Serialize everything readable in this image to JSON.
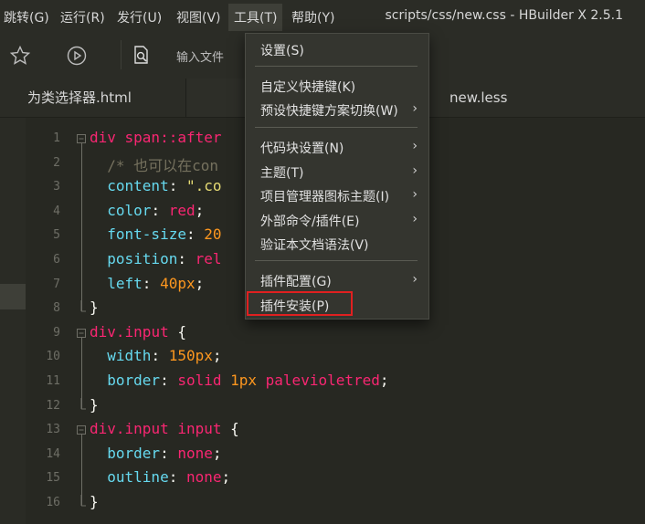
{
  "menubar": {
    "items": [
      "跳转(G)",
      "运行(R)",
      "发行(U)",
      "视图(V)",
      "工具(T)",
      "帮助(Y)"
    ],
    "title": "scripts/css/new.css - HBuilder X 2.5.1"
  },
  "toolbar": {
    "input_placeholder": "输入文件"
  },
  "tabs": [
    "为类选择器.html",
    "new.less"
  ],
  "editor": {
    "lines": [
      {
        "n": "1",
        "parts": [
          {
            "t": "div ",
            "c": "k"
          },
          {
            "t": "span",
            "c": "k"
          },
          {
            "t": "::after",
            "c": "k"
          }
        ]
      },
      {
        "n": "2",
        "parts": [
          {
            "t": "  /* 也可以在con",
            "c": "c"
          }
        ]
      },
      {
        "n": "3",
        "parts": [
          {
            "t": "  content",
            "c": "p"
          },
          {
            "t": ": ",
            "c": "w"
          },
          {
            "t": "\".co",
            "c": "s"
          }
        ]
      },
      {
        "n": "4",
        "parts": [
          {
            "t": "  color",
            "c": "p"
          },
          {
            "t": ": ",
            "c": "w"
          },
          {
            "t": "red",
            "c": "k"
          },
          {
            "t": ";",
            "c": "w"
          }
        ]
      },
      {
        "n": "5",
        "parts": [
          {
            "t": "  font-size",
            "c": "p"
          },
          {
            "t": ": ",
            "c": "w"
          },
          {
            "t": "20",
            "c": "v"
          }
        ]
      },
      {
        "n": "6",
        "parts": [
          {
            "t": "  position",
            "c": "p"
          },
          {
            "t": ": ",
            "c": "w"
          },
          {
            "t": "rel",
            "c": "k"
          }
        ]
      },
      {
        "n": "7",
        "parts": [
          {
            "t": "  left",
            "c": "p"
          },
          {
            "t": ": ",
            "c": "w"
          },
          {
            "t": "40px",
            "c": "v"
          },
          {
            "t": ";",
            "c": "w"
          }
        ]
      },
      {
        "n": "8",
        "parts": [
          {
            "t": "}",
            "c": "w"
          }
        ]
      },
      {
        "n": "9",
        "parts": [
          {
            "t": "div",
            "c": "k"
          },
          {
            "t": ".input",
            "c": "k"
          },
          {
            "t": " {",
            "c": "w"
          }
        ]
      },
      {
        "n": "10",
        "parts": [
          {
            "t": "  width",
            "c": "p"
          },
          {
            "t": ": ",
            "c": "w"
          },
          {
            "t": "150px",
            "c": "v"
          },
          {
            "t": ";",
            "c": "w"
          }
        ]
      },
      {
        "n": "11",
        "parts": [
          {
            "t": "  border",
            "c": "p"
          },
          {
            "t": ": ",
            "c": "w"
          },
          {
            "t": "solid ",
            "c": "k"
          },
          {
            "t": "1px ",
            "c": "v"
          },
          {
            "t": "palevioletred",
            "c": "k"
          },
          {
            "t": ";",
            "c": "w"
          }
        ]
      },
      {
        "n": "12",
        "parts": [
          {
            "t": "}",
            "c": "w"
          }
        ]
      },
      {
        "n": "13",
        "parts": [
          {
            "t": "div",
            "c": "k"
          },
          {
            "t": ".input ",
            "c": "k"
          },
          {
            "t": "input",
            "c": "k"
          },
          {
            "t": " {",
            "c": "w"
          }
        ]
      },
      {
        "n": "14",
        "parts": [
          {
            "t": "  border",
            "c": "p"
          },
          {
            "t": ": ",
            "c": "w"
          },
          {
            "t": "none",
            "c": "k"
          },
          {
            "t": ";",
            "c": "w"
          }
        ]
      },
      {
        "n": "15",
        "parts": [
          {
            "t": "  outline",
            "c": "p"
          },
          {
            "t": ": ",
            "c": "w"
          },
          {
            "t": "none",
            "c": "k"
          },
          {
            "t": ";",
            "c": "w"
          }
        ]
      },
      {
        "n": "16",
        "parts": [
          {
            "t": "}",
            "c": "w"
          }
        ]
      }
    ]
  },
  "tools_menu": {
    "items": [
      {
        "label": "设置(S)",
        "submenu": false
      },
      {
        "label": "自定义快捷键(K)",
        "submenu": false
      },
      {
        "label": "预设快捷键方案切换(W)",
        "submenu": true
      },
      {
        "label": "代码块设置(N)",
        "submenu": true
      },
      {
        "label": "主题(T)",
        "submenu": true
      },
      {
        "label": "项目管理器图标主题(I)",
        "submenu": true
      },
      {
        "label": "外部命令/插件(E)",
        "submenu": true
      },
      {
        "label": "验证本文档语法(V)",
        "submenu": false
      },
      {
        "label": "插件配置(G)",
        "submenu": true
      },
      {
        "label": "插件安装(P)",
        "submenu": false
      }
    ]
  },
  "icons": {
    "toolbar": [
      "star-icon",
      "play-icon",
      "file-search-icon"
    ]
  }
}
